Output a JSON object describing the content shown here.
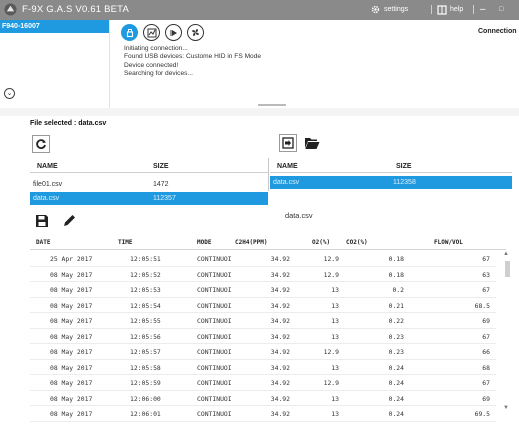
{
  "titlebar": {
    "title": "F-9X G.A.S V0.61 BETA",
    "settings_label": "settings",
    "help_label": "help",
    "minimize_glyph": "–",
    "maximize_glyph": "□"
  },
  "devices": {
    "items": [
      "F940-16007"
    ],
    "expand_glyph": "⌄"
  },
  "toolbar": {
    "icons": [
      "usb-icon",
      "chart-icon",
      "play-icon",
      "fan-icon"
    ],
    "connection_label": "Connection"
  },
  "log": [
    "Initiating connection...",
    "Found USB devices: Custome HID in FS Mode",
    "Device connected!",
    "Searching for devices..."
  ],
  "file_selected": "File selected : data.csv",
  "local_files": {
    "headers": [
      "NAME",
      "SIZE"
    ],
    "rows": [
      {
        "name": "file01.csv",
        "size": "1472",
        "selected": false
      },
      {
        "name": "data.csv",
        "size": "112357",
        "selected": true
      }
    ]
  },
  "device_files": {
    "headers": [
      "NAME",
      "SIZE"
    ],
    "rows": [
      {
        "name": "data.csv",
        "size": "112358",
        "selected": true
      }
    ]
  },
  "data_file_label": "data.csv",
  "data_table": {
    "headers": [
      "DATE",
      "TIME",
      "MODE",
      "C2H4(PPM)",
      "O2(%)",
      "CO2(%)",
      "FLOW/VOL"
    ],
    "rows": [
      [
        "25 Apr 2017",
        "12:05:51",
        "CONTINUOI",
        "34.92",
        "12.9",
        "0.18",
        "67"
      ],
      [
        "08 May 2017",
        "12:05:52",
        "CONTINUOI",
        "34.92",
        "12.9",
        "0.18",
        "63"
      ],
      [
        "08 May 2017",
        "12:05:53",
        "CONTINUOI",
        "34.92",
        "13",
        "0.2",
        "67"
      ],
      [
        "08 May 2017",
        "12:05:54",
        "CONTINUOI",
        "34.92",
        "13",
        "0.21",
        "68.5"
      ],
      [
        "08 May 2017",
        "12:05:55",
        "CONTINUOI",
        "34.92",
        "13",
        "0.22",
        "69"
      ],
      [
        "08 May 2017",
        "12:05:56",
        "CONTINUOI",
        "34.92",
        "13",
        "0.23",
        "67"
      ],
      [
        "08 May 2017",
        "12:05:57",
        "CONTINUOI",
        "34.92",
        "12.9",
        "0.23",
        "66"
      ],
      [
        "08 May 2017",
        "12:05:58",
        "CONTINUOI",
        "34.92",
        "13",
        "0.24",
        "68"
      ],
      [
        "08 May 2017",
        "12:05:59",
        "CONTINUOI",
        "34.92",
        "12.9",
        "0.24",
        "67"
      ],
      [
        "08 May 2017",
        "12:06:00",
        "CONTINUOI",
        "34.92",
        "13",
        "0.24",
        "69"
      ],
      [
        "08 May 2017",
        "12:06:01",
        "CONTINUOI",
        "34.92",
        "13",
        "0.24",
        "69.5"
      ]
    ]
  },
  "colors": {
    "titlebar": "#8a8a8a",
    "accent": "#1f9ae0"
  }
}
